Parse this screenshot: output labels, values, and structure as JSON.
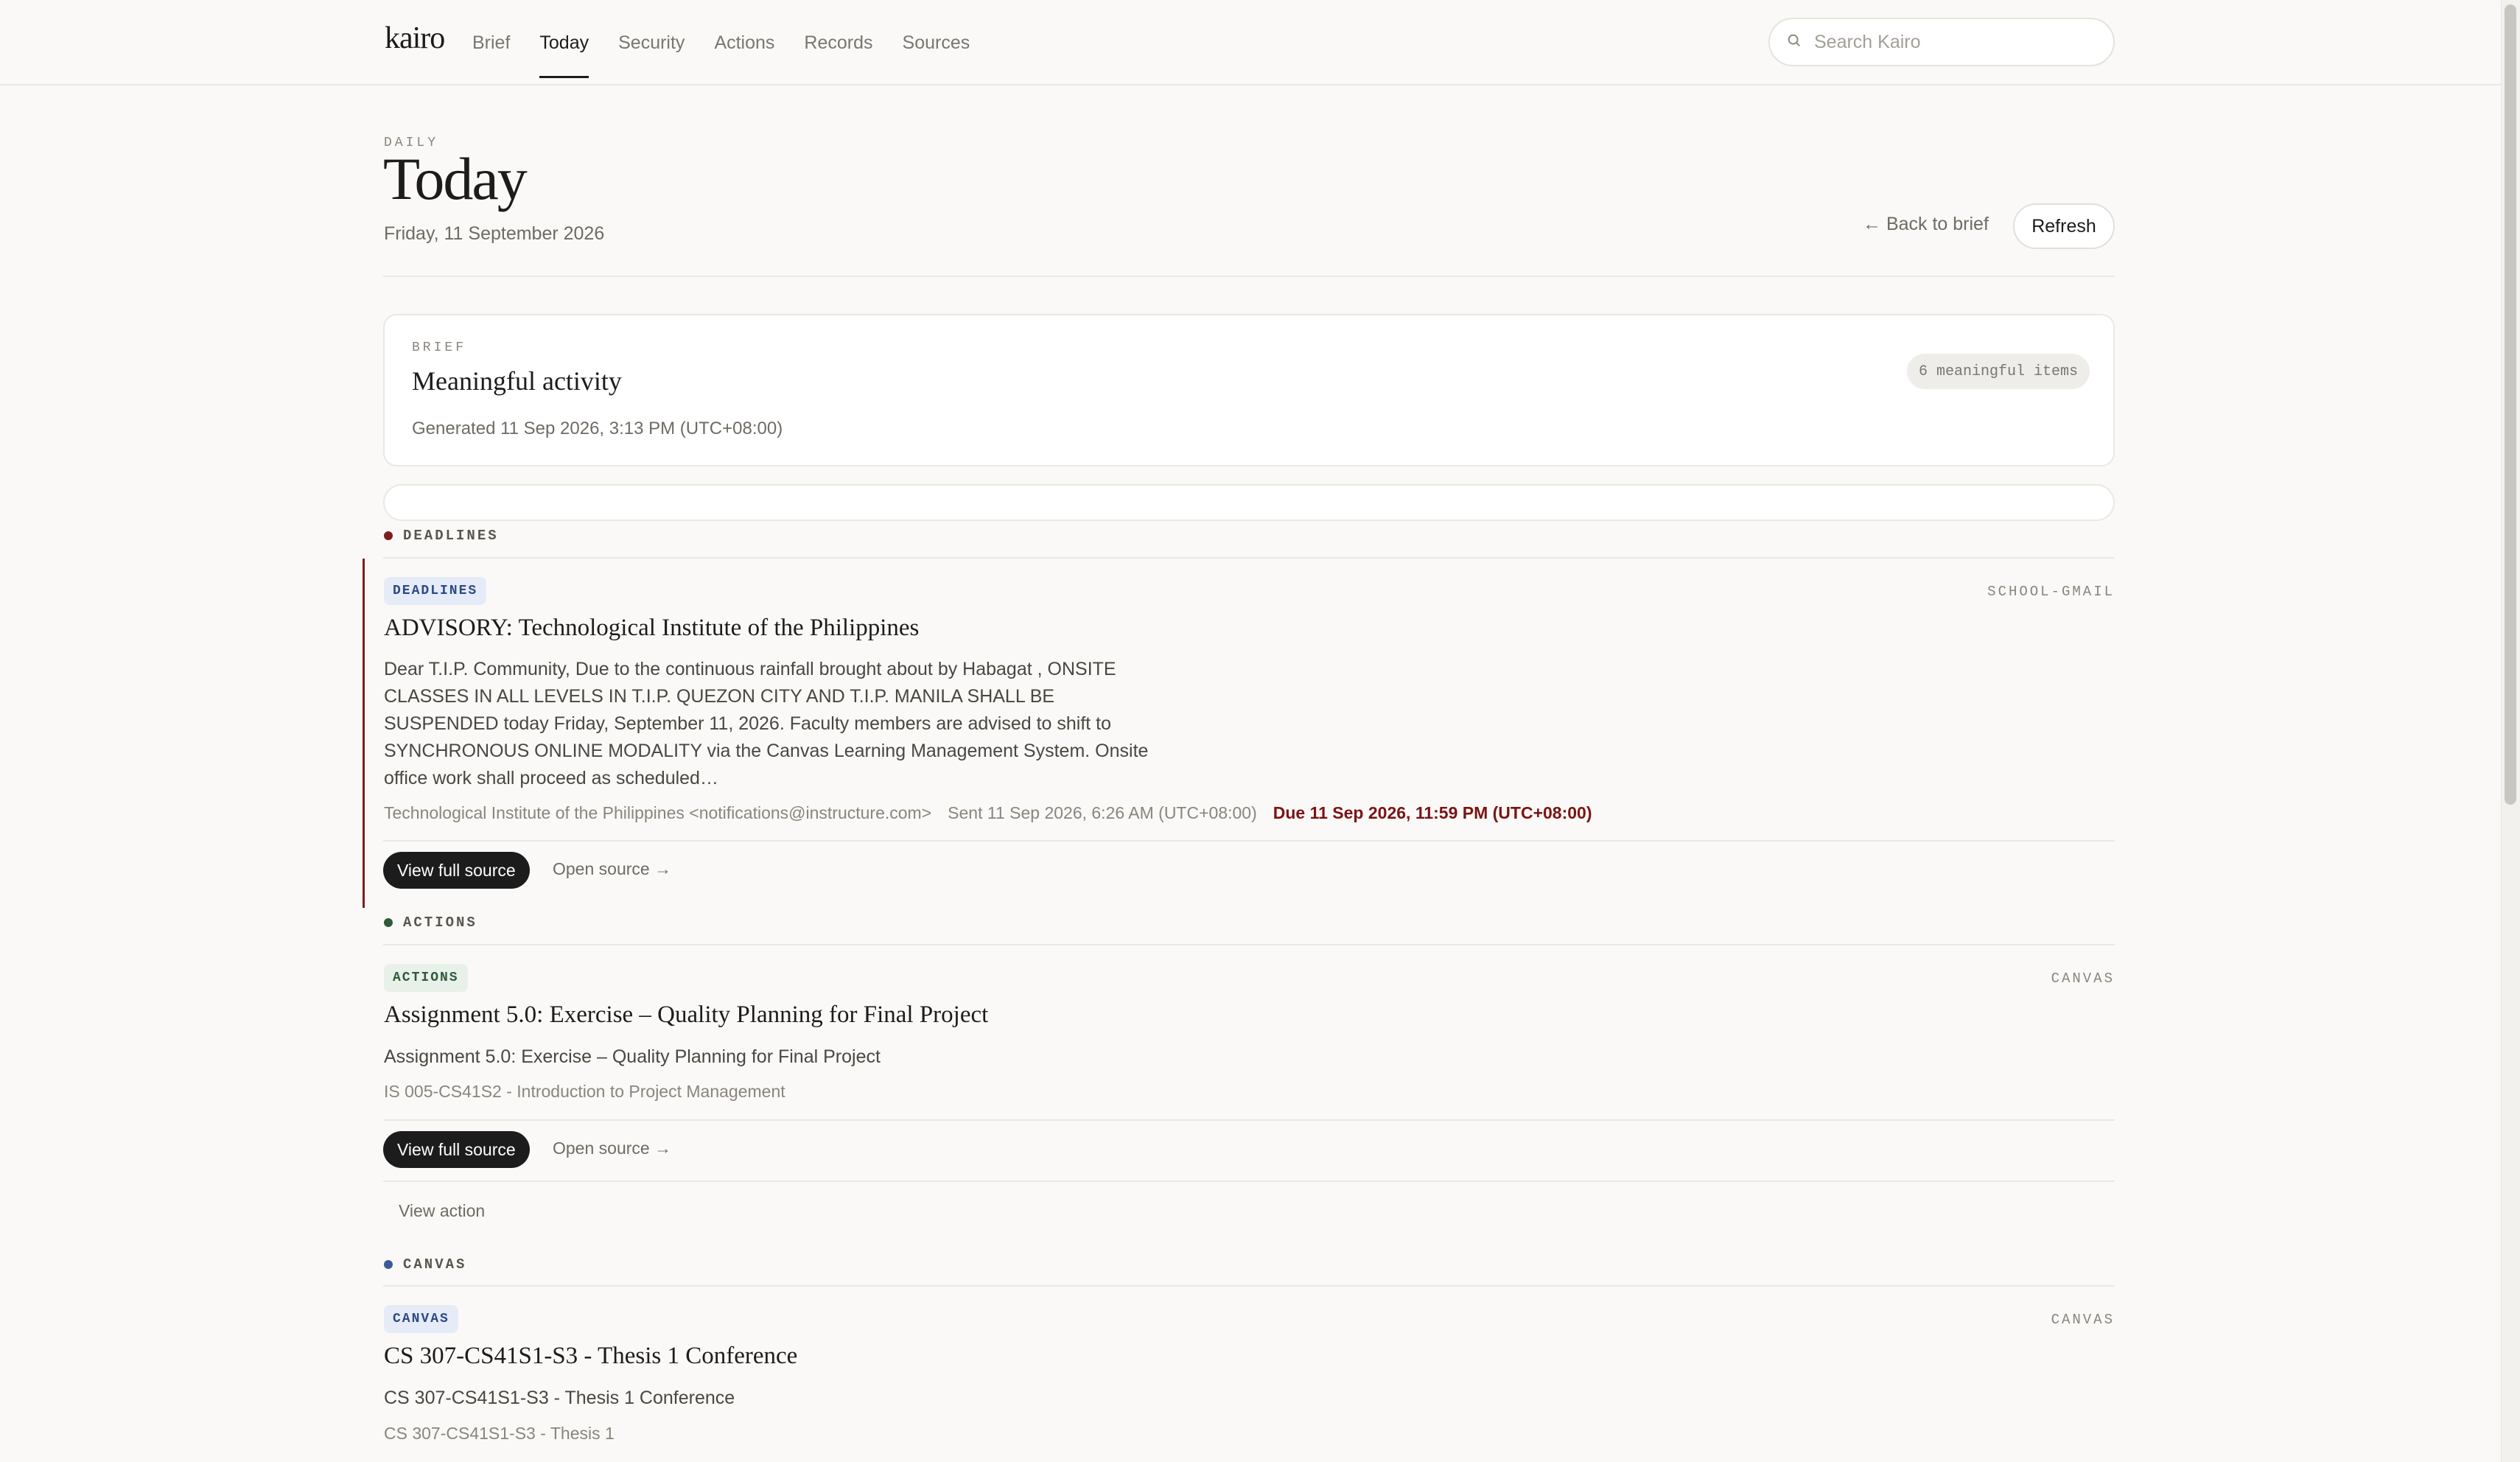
{
  "app": {
    "logo": "kairo"
  },
  "nav": {
    "items": [
      {
        "label": "Brief",
        "active": false
      },
      {
        "label": "Today",
        "active": true
      },
      {
        "label": "Security",
        "active": false
      },
      {
        "label": "Actions",
        "active": false
      },
      {
        "label": "Records",
        "active": false
      },
      {
        "label": "Sources",
        "active": false
      }
    ],
    "search_placeholder": "Search Kairo",
    "search_icon": "search-icon"
  },
  "header": {
    "eyebrow": "DAILY",
    "title": "Today",
    "date": "Friday, 11 September 2026",
    "back_label": "← Back to brief",
    "refresh_label": "Refresh"
  },
  "brief": {
    "eyebrow": "BRIEF",
    "title": "Meaningful activity",
    "generated": "Generated 11 Sep 2026, 3:13 PM (UTC+08:00)",
    "count_badge": "6 meaningful items"
  },
  "sections": [
    {
      "label": "DEADLINES",
      "dot_color": "#7a1f1f",
      "item": {
        "tag": "DEADLINES",
        "tag_bg": "#e6ecf7",
        "tag_color": "#2c4a86",
        "source": "SCHOOL-GMAIL",
        "title": "ADVISORY: Technological Institute of the Philippines",
        "body": "Dear T.I.P. Community, Due to the continuous rainfall brought about by Habagat , ONSITE CLASSES IN ALL LEVELS IN T.I.P. QUEZON CITY AND T.I.P. MANILA SHALL BE SUSPENDED today Friday, September 11, 2026. Faculty members are advised to shift to SYNCHRONOUS ONLINE MODALITY via the Canvas Learning Management System. Onsite office work shall proceed as scheduled…",
        "sender": "Technological Institute of the Philippines <notifications@instructure.com>",
        "sent": "Sent 11 Sep 2026, 6:26 AM (UTC+08:00)",
        "due": "Due 11 Sep 2026, 11:59 PM (UTC+08:00)",
        "view_full_source": "View full source",
        "open_source": "Open source →"
      }
    },
    {
      "label": "ACTIONS",
      "dot_color": "#2f5a3a",
      "item": {
        "tag": "ACTIONS",
        "tag_bg": "#e7f1e9",
        "tag_color": "#2f5a3a",
        "source": "CANVAS",
        "title": "Assignment 5.0: Exercise – Quality Planning for Final Project",
        "subtitle": "Assignment 5.0: Exercise – Quality Planning for Final Project",
        "course": "IS 005-CS41S2 - Introduction to Project Management",
        "view_full_source": "View full source",
        "open_source": "Open source →",
        "view_action": "View action"
      }
    },
    {
      "label": "CANVAS",
      "dot_color": "#3b5a9a",
      "item": {
        "tag": "CANVAS",
        "tag_bg": "#e6ecf7",
        "tag_color": "#2c4a86",
        "source": "CANVAS",
        "title": "CS 307-CS41S1-S3 - Thesis 1 Conference",
        "subtitle": "CS 307-CS41S1-S3 - Thesis 1 Conference",
        "course": "CS 307-CS41S1-S3 - Thesis 1"
      }
    }
  ]
}
